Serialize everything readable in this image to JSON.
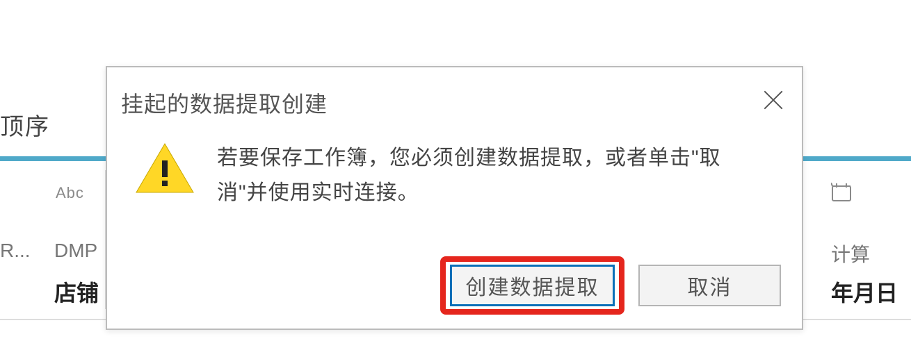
{
  "background": {
    "top_label": "顶序",
    "left_col": {
      "type_badge": "Abc",
      "src": "R...",
      "dmp": "DMP",
      "store": "店铺"
    },
    "right_col": {
      "calc": "计算",
      "ymd": "年月日"
    }
  },
  "dialog": {
    "title": "挂起的数据提取创建",
    "message": "若要保存工作簿，您必须创建数据提取，或者单击\"取消\"并使用实时连接。",
    "primary_btn": "创建数据提取",
    "cancel_btn": "取消"
  }
}
